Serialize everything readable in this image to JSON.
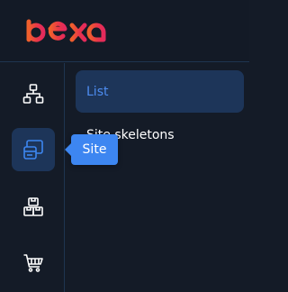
{
  "brand": {
    "logo_text": "ibexa"
  },
  "rail": {
    "items": [
      {
        "icon": "sitemap-icon",
        "active": false
      },
      {
        "icon": "site-icon",
        "active": true
      },
      {
        "icon": "blocks-icon",
        "active": false
      },
      {
        "icon": "cart-icon",
        "active": false
      }
    ]
  },
  "submenu": {
    "items": [
      {
        "label": "List",
        "active": true
      },
      {
        "label": "Site skeletons",
        "active": false
      }
    ]
  },
  "tooltip": {
    "text": "Site"
  },
  "colors": {
    "background": "#141b27",
    "accent": "#3d86f1",
    "active_bg": "#1d3559",
    "brand_gradient_start": "#e82d4b",
    "brand_gradient_end": "#f0602c"
  }
}
